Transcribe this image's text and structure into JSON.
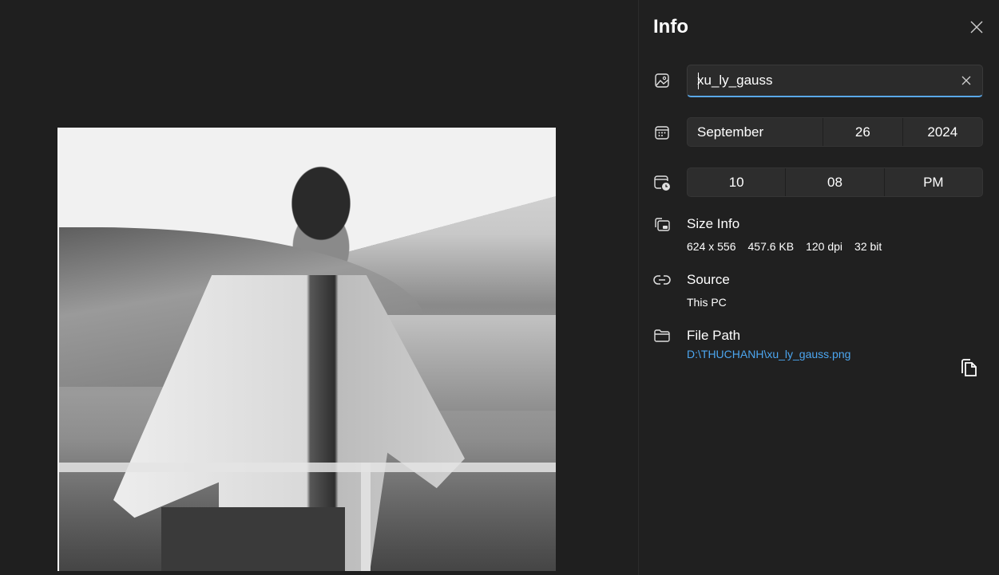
{
  "panel": {
    "title": "Info",
    "name_value": "xu_ly_gauss",
    "date": {
      "month": "September",
      "day": "26",
      "year": "2024"
    },
    "time": {
      "hour": "10",
      "minute": "08",
      "period": "PM"
    },
    "size_info": {
      "title": "Size Info",
      "dimensions": "624 x 556",
      "file_size": "457.6 KB",
      "dpi": "120 dpi",
      "bit_depth": "32 bit"
    },
    "source": {
      "title": "Source",
      "value": "This PC"
    },
    "file_path": {
      "title": "File Path",
      "value": "D:\\THUCHANH\\xu_ly_gauss.png"
    },
    "accent_color": "#4ca6f0"
  },
  "icons": {
    "close": "close-icon",
    "clear": "clear-icon",
    "image": "image-icon",
    "calendar": "calendar-icon",
    "time": "calendar-clock-icon",
    "size": "size-info-icon",
    "source": "link-icon",
    "folder": "folder-icon",
    "copy": "copy-icon"
  }
}
